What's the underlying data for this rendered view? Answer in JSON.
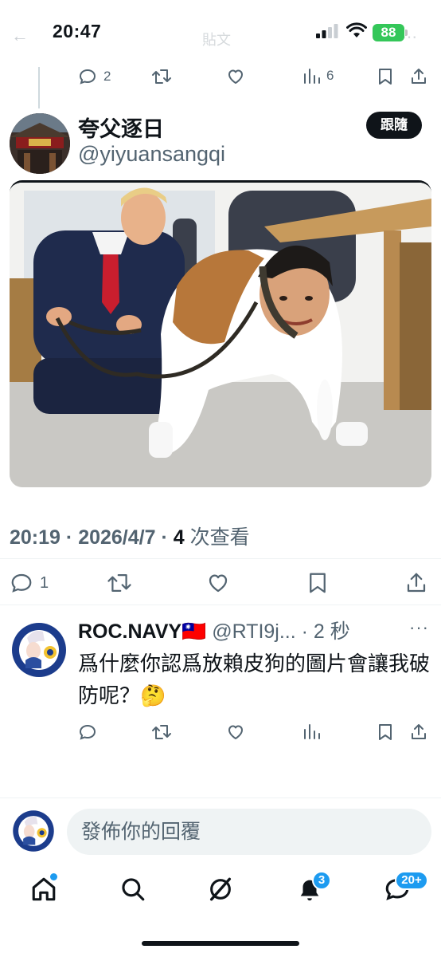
{
  "status_bar": {
    "time": "20:47",
    "battery": "88"
  },
  "header_faded": {
    "back": "←",
    "title": "貼文",
    "more": "⋯"
  },
  "parent_actions": {
    "replies": "2",
    "views": "6"
  },
  "author": {
    "name": "夸父逐日",
    "handle": "@yiyuansangqi",
    "follow_label": "跟隨"
  },
  "tweet_meta": {
    "time": "20:19",
    "date": "2026/4/7",
    "views_count": "4",
    "views_label": "次查看"
  },
  "tweet_actions": {
    "replies": "1"
  },
  "reply": {
    "name": "ROC.NAVY",
    "flag": "🇹🇼",
    "handle": "@RTI9j...",
    "time": "2 秒",
    "text": "爲什麼你認爲放賴皮狗的圖片會讓我破防呢？🤔"
  },
  "compose": {
    "placeholder": "發佈你的回覆"
  },
  "bottom_nav": {
    "notifications_badge": "3",
    "messages_badge": "20+"
  },
  "icons": [
    "reply-icon",
    "retweet-icon",
    "like-icon",
    "views-icon",
    "bookmark-icon",
    "share-icon",
    "home-icon",
    "search-icon",
    "grok-icon",
    "bell-icon",
    "messages-icon"
  ],
  "colors": {
    "text": "#0f1419",
    "muted": "#536471",
    "accent": "#1d9bf0",
    "battery": "#34c759"
  }
}
